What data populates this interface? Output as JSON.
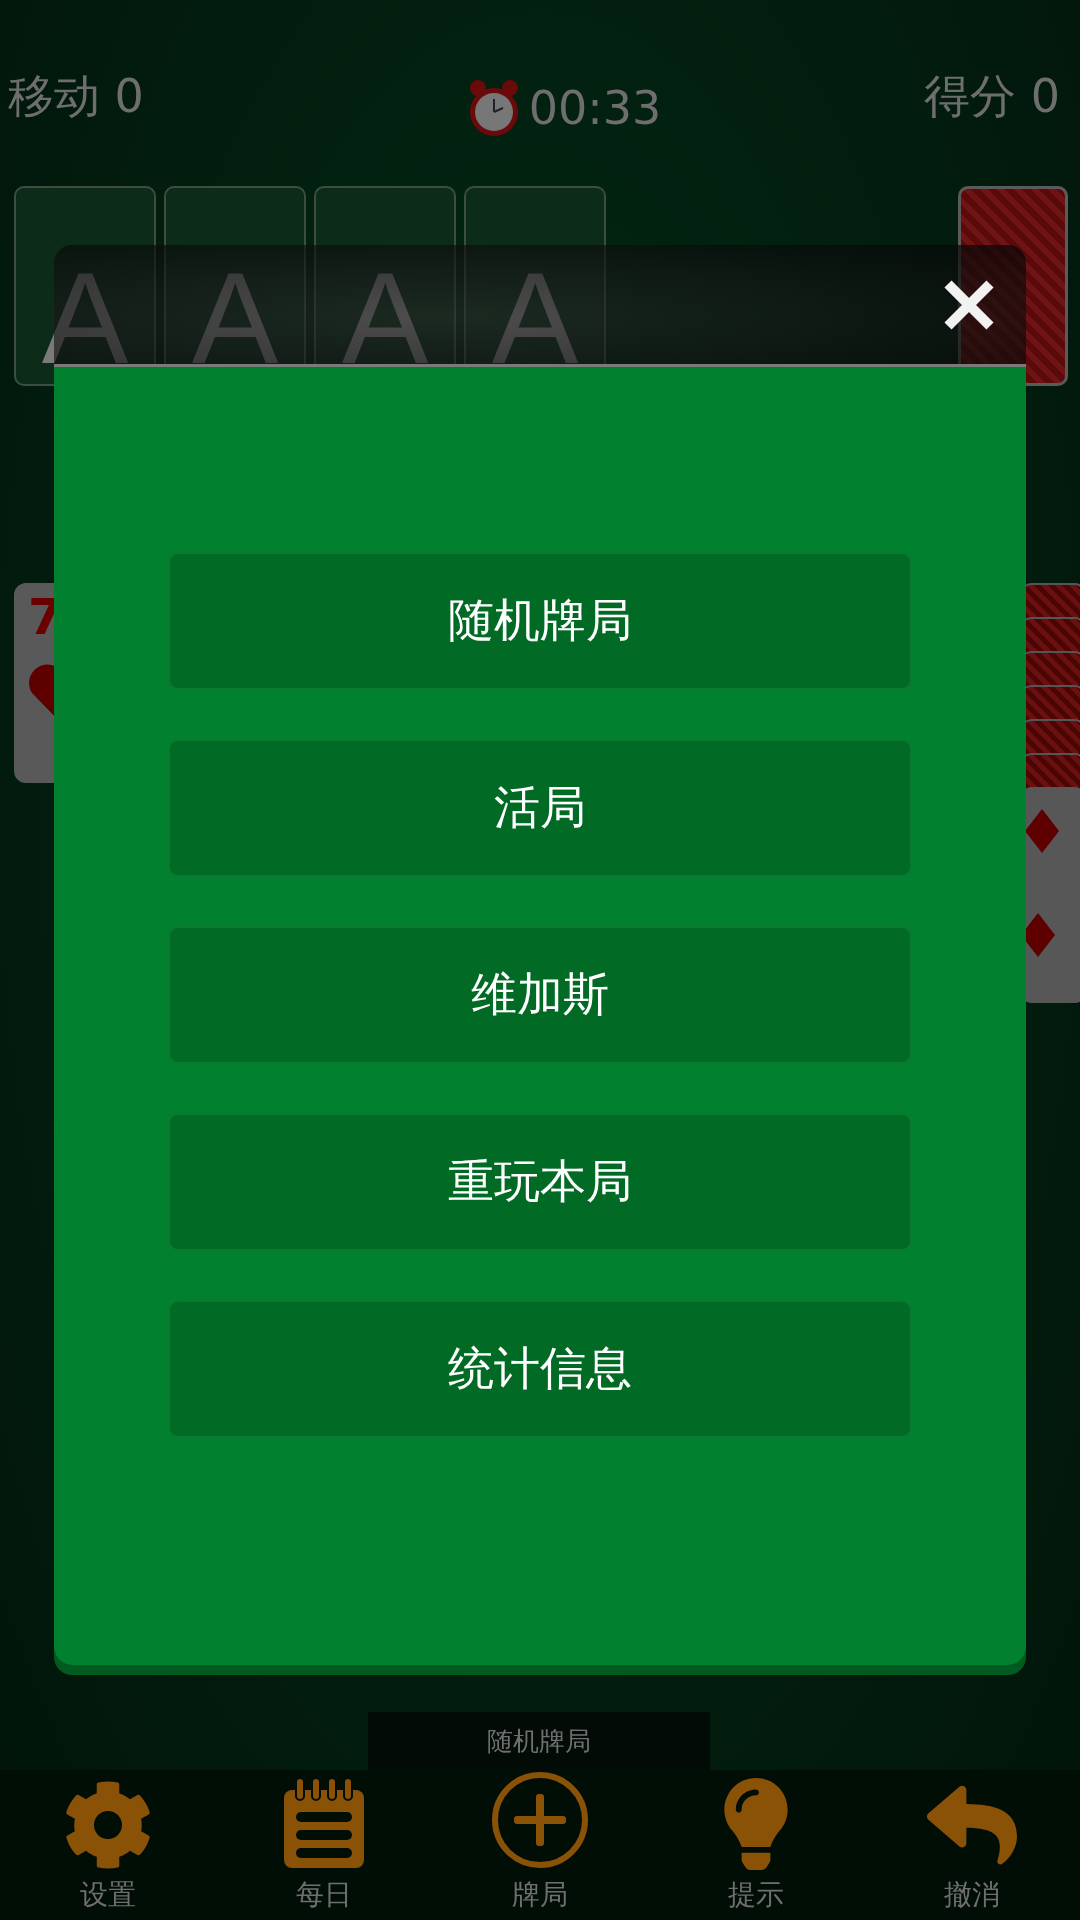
{
  "status": {
    "moves": "移动 0",
    "time": "00:33",
    "score": "得分 0"
  },
  "foundations": [
    "A",
    "A",
    "A",
    "A"
  ],
  "tableau_card": {
    "rank": "7"
  },
  "dialog": {
    "buttons": [
      "随机牌局",
      "活局",
      "维加斯",
      "重玩本局",
      "统计信息"
    ]
  },
  "toast": "随机牌局",
  "toolbar": [
    {
      "label": "设置"
    },
    {
      "label": "每日"
    },
    {
      "label": "牌局"
    },
    {
      "label": "提示"
    },
    {
      "label": "撤消"
    }
  ]
}
